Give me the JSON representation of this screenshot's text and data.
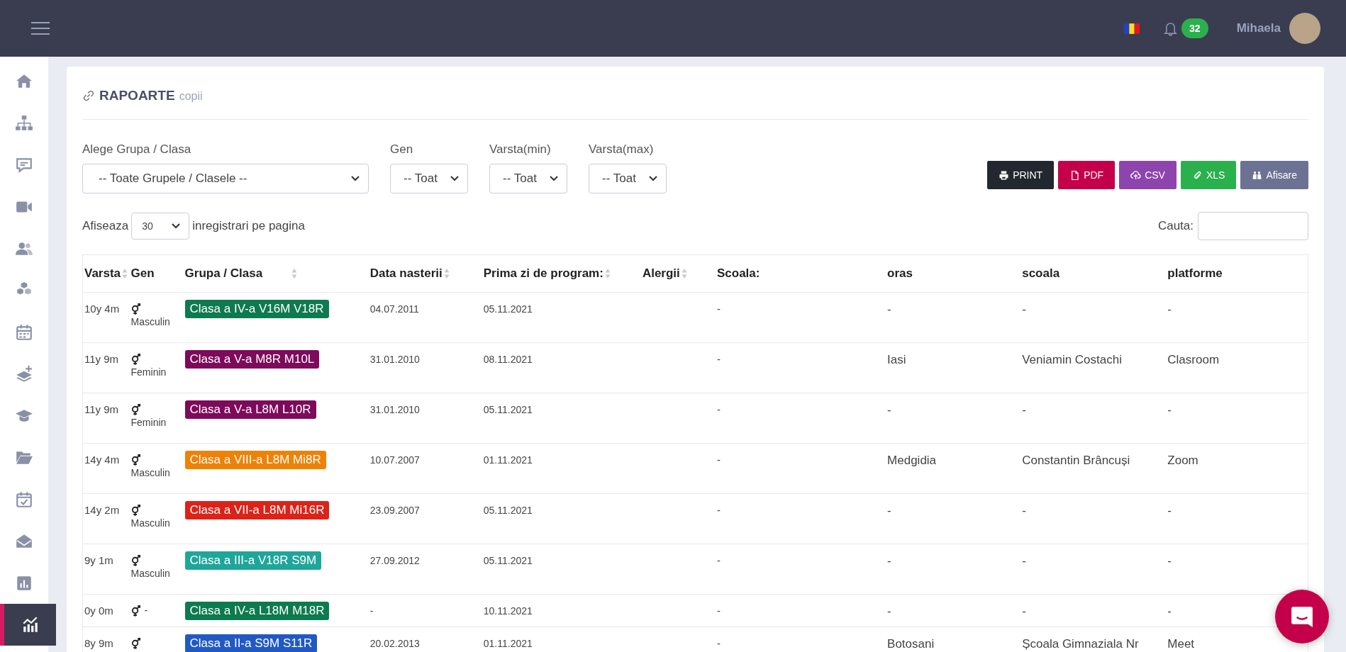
{
  "top_bar": {
    "notification_count": "32",
    "user_name": "Mihaela"
  },
  "sidebar": {
    "items": [
      {
        "selected": false
      },
      {
        "selected": false
      },
      {
        "selected": false
      },
      {
        "selected": false
      },
      {
        "selected": false
      },
      {
        "selected": false
      },
      {
        "selected": false
      },
      {
        "selected": false
      },
      {
        "selected": false
      },
      {
        "selected": false
      },
      {
        "selected": false
      },
      {
        "selected": false
      },
      {
        "selected": false
      },
      {
        "selected": true
      }
    ]
  },
  "page": {
    "title": "RAPOARTE",
    "subtitle": "copii"
  },
  "filters": [
    {
      "label": "Alege Grupa / Clasa",
      "value": "-- Toate Grupele / Clasele --",
      "kind": "wide"
    },
    {
      "label": "Gen",
      "value": "-- Toat",
      "kind": "narrow"
    },
    {
      "label": "Varsta(min)",
      "value": "-- Toat",
      "kind": "narrow"
    },
    {
      "label": "Varsta(max)",
      "value": "-- Toat",
      "kind": "narrow"
    }
  ],
  "export_buttons": [
    {
      "label": "PRINT",
      "kind": "print",
      "color": "#23272f"
    },
    {
      "label": "PDF",
      "kind": "pdf",
      "color": "#c5004a"
    },
    {
      "label": "CSV",
      "kind": "csv",
      "color": "#8e44ad"
    },
    {
      "label": "XLS",
      "kind": "xls",
      "color": "#2bb04e"
    },
    {
      "label": "Afisare",
      "kind": "view",
      "color": "#6c7293"
    }
  ],
  "page_size": {
    "prefix": "Afiseaza",
    "value": "30",
    "suffix": "inregistrari pe pagina"
  },
  "search": {
    "label": "Cauta:"
  },
  "table": {
    "columns": [
      {
        "label": "Varsta",
        "sortable": true
      },
      {
        "label": "Gen",
        "sortable": false
      },
      {
        "label": "Grupa / Clasa",
        "sortable": true
      },
      {
        "label": "Data nasterii",
        "sortable": true
      },
      {
        "label": "Prima zi de program:",
        "sortable": true
      },
      {
        "label": "Alergii",
        "sortable": true
      },
      {
        "label": "Scoala:",
        "sortable": false
      },
      {
        "label": "oras",
        "sortable": false
      },
      {
        "label": "scoala",
        "sortable": false
      },
      {
        "label": "platforme",
        "sortable": false
      }
    ],
    "rows": [
      {
        "varsta": "10y 4m",
        "gen": "Masculin",
        "group": {
          "label": "Clasa a IV-a V16M V18R",
          "color": "#0d7a4f"
        },
        "data_nasterii": "04.07.2011",
        "prima_zi": "05.11.2021",
        "scoala_field": "-",
        "oras": "-",
        "scoala": "-",
        "platforme": "-"
      },
      {
        "varsta": "11y 9m",
        "gen": "Feminin",
        "group": {
          "label": "Clasa a V-a M8R M10L",
          "color": "#7d0a5a"
        },
        "data_nasterii": "31.01.2010",
        "prima_zi": "08.11.2021",
        "scoala_field": "-",
        "oras": "Iasi",
        "scoala": "Veniamin Costachi",
        "platforme": "Clasroom"
      },
      {
        "varsta": "11y 9m",
        "gen": "Feminin",
        "group": {
          "label": "Clasa a V-a L8M L10R",
          "color": "#7d0a5a"
        },
        "data_nasterii": "31.01.2010",
        "prima_zi": "05.11.2021",
        "scoala_field": "-",
        "oras": "-",
        "scoala": "-",
        "platforme": "-"
      },
      {
        "varsta": "14y 4m",
        "gen": "Masculin",
        "group": {
          "label": "Clasa a VIII-a L8M Mi8R",
          "color": "#ee8206"
        },
        "data_nasterii": "10.07.2007",
        "prima_zi": "01.11.2021",
        "scoala_field": "-",
        "oras": "Medgidia",
        "scoala": "Constantin Brâncuși",
        "platforme": "Zoom"
      },
      {
        "varsta": "14y 2m",
        "gen": "Masculin",
        "group": {
          "label": "Clasa a VII-a L8M Mi16R",
          "color": "#dd2218"
        },
        "data_nasterii": "23.09.2007",
        "prima_zi": "05.11.2021",
        "scoala_field": "-",
        "oras": "-",
        "scoala": "-",
        "platforme": "-"
      },
      {
        "varsta": "9y 1m",
        "gen": "Masculin",
        "group": {
          "label": "Clasa a III-a V18R S9M",
          "color": "#1fa69a"
        },
        "data_nasterii": "27.09.2012",
        "prima_zi": "05.11.2021",
        "scoala_field": "-",
        "oras": "-",
        "scoala": "-",
        "platforme": "-"
      },
      {
        "varsta": "0y 0m",
        "gen": "-",
        "group": {
          "label": "Clasa a IV-a L18M M18R",
          "color": "#0d7a4f"
        },
        "data_nasterii": "-",
        "prima_zi": "10.11.2021",
        "scoala_field": "-",
        "oras": "-",
        "scoala": "-",
        "platforme": "-"
      },
      {
        "varsta": "8y 9m",
        "group": {
          "label": "Clasa a II-a S9M S11R",
          "color": "#2159c4"
        },
        "data_nasterii": "20.02.2013",
        "prima_zi": "01.11.2021",
        "scoala_field": "-",
        "oras": "Botosani",
        "scoala": "Școala Gimnaziala Nr",
        "platforme": "Meet"
      }
    ]
  }
}
